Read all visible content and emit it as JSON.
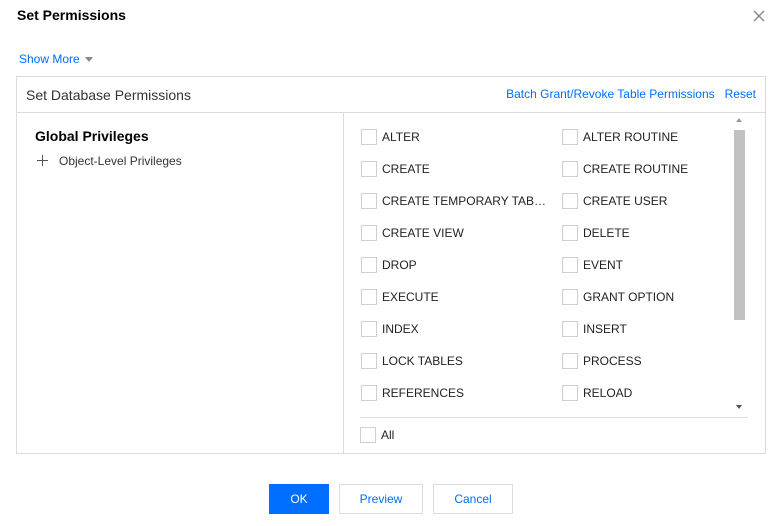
{
  "dialog": {
    "title": "Set Permissions",
    "close_icon": "close-icon"
  },
  "show_more": {
    "label": "Show More",
    "icon": "caret-down-icon"
  },
  "panel": {
    "title": "Set Database Permissions",
    "batch_link": "Batch Grant/Revoke Table Permissions",
    "reset_link": "Reset"
  },
  "tree": {
    "root": "Global Privileges",
    "child": "Object-Level Privileges",
    "child_icon": "plus-icon"
  },
  "privileges": [
    "ALTER",
    "ALTER ROUTINE",
    "CREATE",
    "CREATE ROUTINE",
    "CREATE TEMPORARY TABLES",
    "CREATE USER",
    "CREATE VIEW",
    "DELETE",
    "DROP",
    "EVENT",
    "EXECUTE",
    "GRANT OPTION",
    "INDEX",
    "INSERT",
    "LOCK TABLES",
    "PROCESS",
    "REFERENCES",
    "RELOAD"
  ],
  "all_label": "All",
  "buttons": {
    "ok": "OK",
    "preview": "Preview",
    "cancel": "Cancel"
  },
  "colors": {
    "accent": "#006eff",
    "border": "#dcdcdc"
  }
}
